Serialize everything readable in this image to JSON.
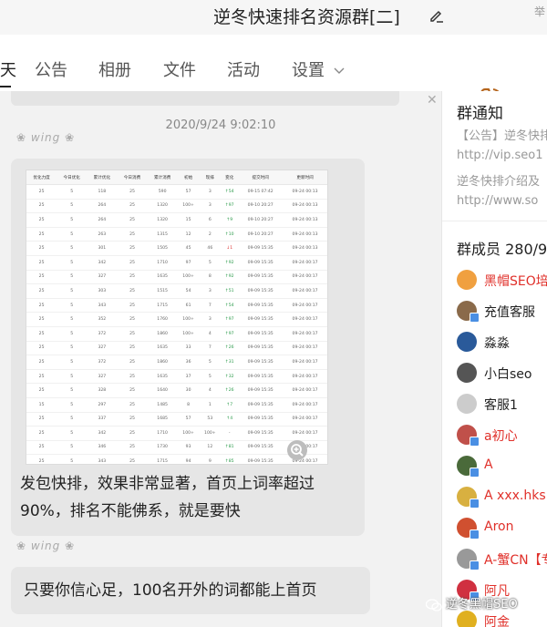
{
  "window": {
    "title": "逆冬快速排名资源群[二]",
    "corner_text": "举"
  },
  "tabs": [
    {
      "label": "天",
      "active": true
    },
    {
      "label": "公告",
      "active": false
    },
    {
      "label": "相册",
      "active": false
    },
    {
      "label": "文件",
      "active": false
    },
    {
      "label": "活动",
      "active": false
    },
    {
      "label": "设置",
      "active": false
    }
  ],
  "chat": {
    "timestamp": "2020/9/24 9:02:10",
    "avatar_deco": "wing",
    "message1": {
      "line1": "发包快排，效果非常显著，首页上词率超过",
      "line2": "90%，排名不能佛系，就是要快"
    },
    "message2": {
      "text": "只要你信心足，100名开外的词都能上首页"
    },
    "screenshot_table": {
      "headers": [
        "优化力度",
        "今日优化",
        "累计优化",
        "今日消费",
        "累计消费",
        "初始",
        "现排",
        "变化",
        "提交时间",
        "更新时间"
      ],
      "rows": [
        [
          "25",
          "5",
          "118",
          "25",
          "590",
          "57",
          "3",
          "↑54",
          "09-15 07:42",
          "09-24 00:13"
        ],
        [
          "25",
          "5",
          "264",
          "25",
          "1320",
          "100+",
          "3",
          "↑97",
          "09-10 20:27",
          "09-24 00:13"
        ],
        [
          "25",
          "5",
          "264",
          "25",
          "1320",
          "15",
          "6",
          "↑9",
          "09-10 20:27",
          "09-24 00:13"
        ],
        [
          "25",
          "5",
          "263",
          "25",
          "1315",
          "12",
          "2",
          "↑10",
          "09-10 20:27",
          "09-24 00:13"
        ],
        [
          "25",
          "5",
          "301",
          "25",
          "1505",
          "45",
          "46",
          "↓1",
          "09-09 15:35",
          "09-24 00:13"
        ],
        [
          "25",
          "5",
          "342",
          "25",
          "1710",
          "97",
          "5",
          "↑92",
          "09-09 15:35",
          "09-24 00:17"
        ],
        [
          "25",
          "5",
          "327",
          "25",
          "1635",
          "100+",
          "8",
          "↑92",
          "09-09 15:35",
          "09-24 00:17"
        ],
        [
          "25",
          "5",
          "303",
          "25",
          "1515",
          "54",
          "3",
          "↑51",
          "09-09 15:35",
          "09-24 00:17"
        ],
        [
          "25",
          "5",
          "343",
          "25",
          "1715",
          "61",
          "7",
          "↑54",
          "09-09 15:35",
          "09-24 00:17"
        ],
        [
          "25",
          "5",
          "352",
          "25",
          "1760",
          "100+",
          "3",
          "↑97",
          "09-09 15:35",
          "09-24 00:17"
        ],
        [
          "25",
          "5",
          "372",
          "25",
          "1860",
          "100+",
          "4",
          "↑97",
          "09-09 15:35",
          "09-24 00:17"
        ],
        [
          "25",
          "5",
          "327",
          "25",
          "1635",
          "33",
          "7",
          "↑26",
          "09-09 15:35",
          "09-24 00:17"
        ],
        [
          "25",
          "5",
          "372",
          "25",
          "1860",
          "36",
          "5",
          "↑31",
          "09-09 15:35",
          "09-24 00:17"
        ],
        [
          "25",
          "5",
          "327",
          "25",
          "1635",
          "37",
          "5",
          "↑32",
          "09-09 15:35",
          "09-24 00:17"
        ],
        [
          "25",
          "5",
          "328",
          "25",
          "1640",
          "30",
          "4",
          "↑26",
          "09-09 15:35",
          "09-24 00:17"
        ],
        [
          "15",
          "5",
          "297",
          "25",
          "1485",
          "8",
          "1",
          "↑7",
          "09-09 15:35",
          "09-24 00:17"
        ],
        [
          "25",
          "5",
          "337",
          "25",
          "1685",
          "57",
          "53",
          "↑4",
          "09-09 15:35",
          "09-24 00:17"
        ],
        [
          "25",
          "5",
          "342",
          "25",
          "1710",
          "100+",
          "100+",
          "-",
          "09-09 15:35",
          "09-24 00:17"
        ],
        [
          "25",
          "5",
          "346",
          "25",
          "1730",
          "93",
          "12",
          "↑81",
          "09-09 15:35",
          "09-24 00:17"
        ],
        [
          "25",
          "5",
          "343",
          "25",
          "1715",
          "94",
          "9",
          "↑85",
          "09-09 15:35",
          "09-24 00:17"
        ],
        [
          "25",
          "5",
          "306",
          "25",
          "1530",
          "56",
          "53",
          "↑3",
          "09-09 15:35",
          "09-24 00:17"
        ]
      ]
    }
  },
  "notice": {
    "title": "群通知",
    "line1": "【公告】逆冬快排",
    "line2": "http://vip.seo1",
    "line3": "逆冬快排介绍及",
    "line4": "http://www.so"
  },
  "members": {
    "title": "群成员 280/9",
    "list": [
      {
        "name": "黑帽SEO培",
        "red": true,
        "color": "#f0a040"
      },
      {
        "name": "充值客服",
        "red": false,
        "color": "#8a6a4a"
      },
      {
        "name": "淼淼",
        "red": false,
        "color": "#2a5a9a"
      },
      {
        "name": "小白seo",
        "red": false,
        "color": "#555555"
      },
      {
        "name": "客服1",
        "red": false,
        "color": "#cccccc"
      },
      {
        "name": "a初心",
        "red": true,
        "color": "#c0504a"
      },
      {
        "name": "A",
        "red": true,
        "color": "#4a6a3a"
      },
      {
        "name": "A  xxx.hks",
        "red": true,
        "color": "#d8b040"
      },
      {
        "name": "Aron",
        "red": true,
        "color": "#d05030"
      },
      {
        "name": "A-蟹CN【专",
        "red": true,
        "color": "#999999"
      },
      {
        "name": "阿凡",
        "red": true,
        "color": "#d03040"
      },
      {
        "name": "阿金",
        "red": true,
        "color": "#e0b020"
      }
    ]
  },
  "watermark": "逆冬黑帽SEO"
}
